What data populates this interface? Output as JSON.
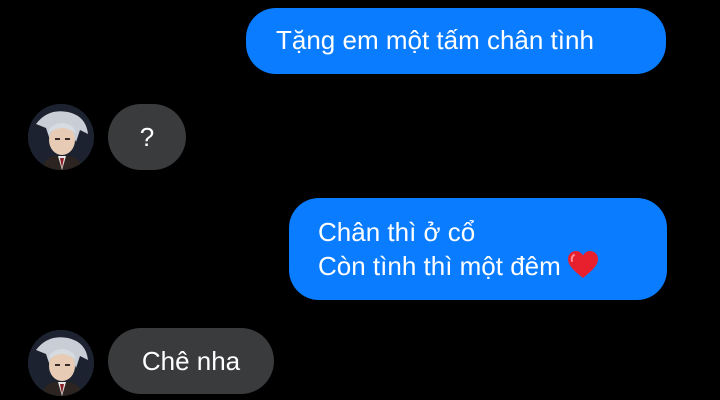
{
  "conversation": {
    "messages": [
      {
        "sender": "me",
        "text": "Tặng em một tấm chân tình"
      },
      {
        "sender": "contact",
        "text": "?"
      },
      {
        "sender": "me",
        "lines": [
          "Chân thì ở cổ",
          "Còn tình thì một đêm"
        ],
        "emoji": "red-heart-icon"
      },
      {
        "sender": "contact",
        "text": "Chê nha"
      }
    ]
  },
  "colors": {
    "background": "#000000",
    "outgoing_bubble": "#0a7cff",
    "incoming_bubble": "#3a3b3c",
    "text": "#ffffff",
    "heart": "#e8202e"
  }
}
